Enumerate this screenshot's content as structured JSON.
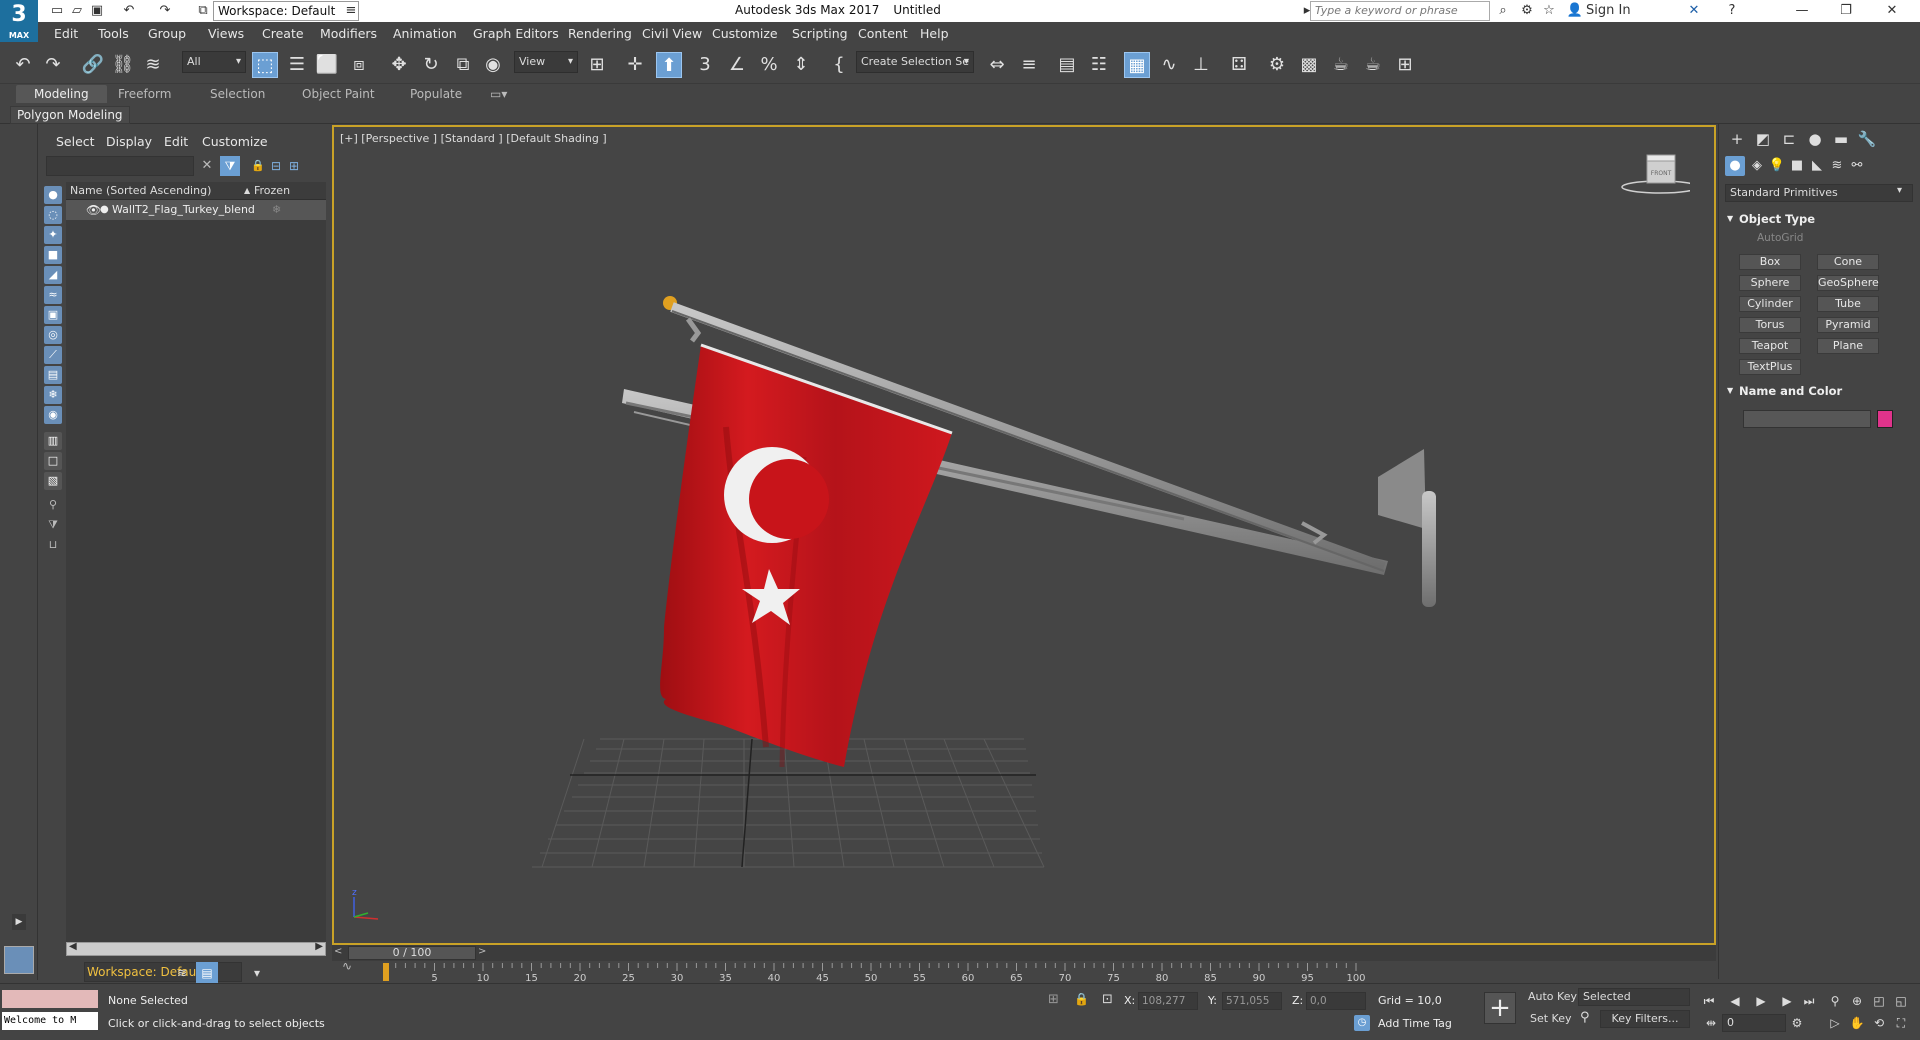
{
  "app": {
    "logo_text": "3",
    "logo_sub": "MAX",
    "title": "Autodesk 3ds Max 2017",
    "document": "Untitled",
    "workspace": "Workspace: Default",
    "search_placeholder": "Type a keyword or phrase",
    "sign_in": "Sign In"
  },
  "menu": [
    "Edit",
    "Tools",
    "Group",
    "Views",
    "Create",
    "Modifiers",
    "Animation",
    "Graph Editors",
    "Rendering",
    "Civil View",
    "Customize",
    "Scripting",
    "Content",
    "Help"
  ],
  "toolbar": {
    "filter_value": "All",
    "refcoord_value": "View",
    "selection_set_placeholder": "Create Selection Se"
  },
  "ribbon": {
    "tabs": [
      "Modeling",
      "Freeform",
      "Selection",
      "Object Paint",
      "Populate"
    ],
    "sub_label": "Polygon Modeling"
  },
  "explorer": {
    "menu": [
      "Select",
      "Display",
      "Edit",
      "Customize"
    ],
    "col_name": "Name (Sorted Ascending)",
    "col_frozen": "Frozen",
    "rows": [
      {
        "name": "WallT2_Flag_Turkey_blend"
      }
    ],
    "workspace": "Workspace: Default"
  },
  "viewport": {
    "label": "[+] [Perspective ] [Standard ] [Default Shading ]",
    "viewcube_label": "FRONT",
    "flag_color": "#c8141a",
    "emblem_color": "#f0f0f0"
  },
  "command_panel": {
    "category": "Standard Primitives",
    "object_type_title": "Object Type",
    "autogrid": "AutoGrid",
    "buttons": [
      "Box",
      "Cone",
      "Sphere",
      "GeoSphere",
      "Cylinder",
      "Tube",
      "Torus",
      "Pyramid",
      "Teapot",
      "Plane",
      "TextPlus"
    ],
    "name_color_title": "Name and Color",
    "object_color": "#e0338b"
  },
  "timeline": {
    "frame_display": "0 / 100",
    "ticks": [
      "5",
      "10",
      "15",
      "20",
      "25",
      "30",
      "35",
      "40",
      "45",
      "50",
      "55",
      "60",
      "65",
      "70",
      "75",
      "80",
      "85",
      "90",
      "95",
      "100"
    ]
  },
  "status": {
    "maxscript_text": "Welcome to M",
    "selection": "None Selected",
    "prompt": "Click or click-and-drag to select objects",
    "x_label": "X:",
    "x_value": "108,277",
    "y_label": "Y:",
    "y_value": "571,055",
    "z_label": "Z:",
    "z_value": "0,0",
    "grid": "Grid = 10,0",
    "add_time_tag": "Add Time Tag",
    "auto_key": "Auto Key",
    "set_key": "Set Key",
    "key_mode": "Selected",
    "key_filters": "Key Filters...",
    "frame": "0"
  }
}
